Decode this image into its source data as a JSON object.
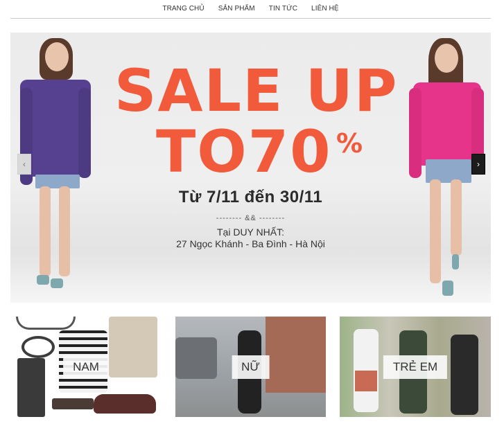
{
  "nav": {
    "items": [
      "TRANG CHỦ",
      "SẢN PHẨM",
      "TIN TỨC",
      "LIÊN HỆ"
    ]
  },
  "hero": {
    "line1": "SALE UP",
    "line2": "TO70",
    "percent": "%",
    "dates": "Từ 7/11 đến 30/11",
    "divider": "-------- && --------",
    "at": "Tại DUY NHẤT:",
    "address": "27 Ngọc Khánh - Ba Đình - Hà Nội",
    "prev_icon": "chevron-left-icon",
    "next_icon": "chevron-right-icon",
    "prev_glyph": "‹",
    "next_glyph": "›",
    "accent_color": "#f15a3b"
  },
  "categories": [
    {
      "label": "NAM"
    },
    {
      "label": "NỮ"
    },
    {
      "label": "TRẺ EM"
    }
  ]
}
